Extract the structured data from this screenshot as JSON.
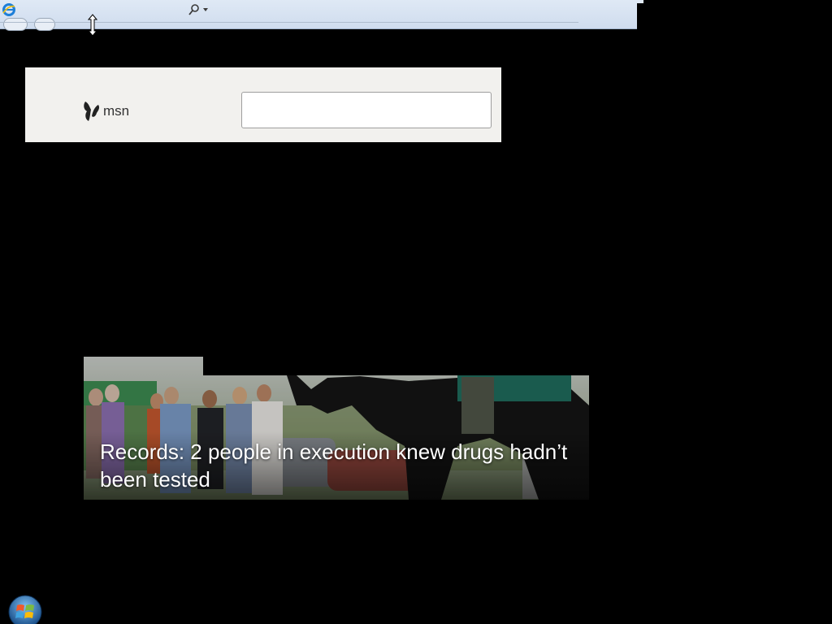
{
  "browser": {
    "icon": "ie-icon",
    "address_search_icon": "search-icon",
    "back_icon": "back-arrow-icon",
    "forward_icon": "forward-arrow-icon"
  },
  "msn": {
    "logo_icon": "msn-butterfly-icon",
    "brand_text": "msn",
    "search_value": "",
    "search_placeholder": ""
  },
  "news": {
    "headline": "Records: 2 people in execution knew drugs hadn’t been tested"
  },
  "taskbar": {
    "start_icon": "windows-start-orb-icon"
  },
  "colors": {
    "header_bg": "#f2f1ee",
    "page_bg": "#000000",
    "chrome_bg": "#dfe9f5"
  }
}
